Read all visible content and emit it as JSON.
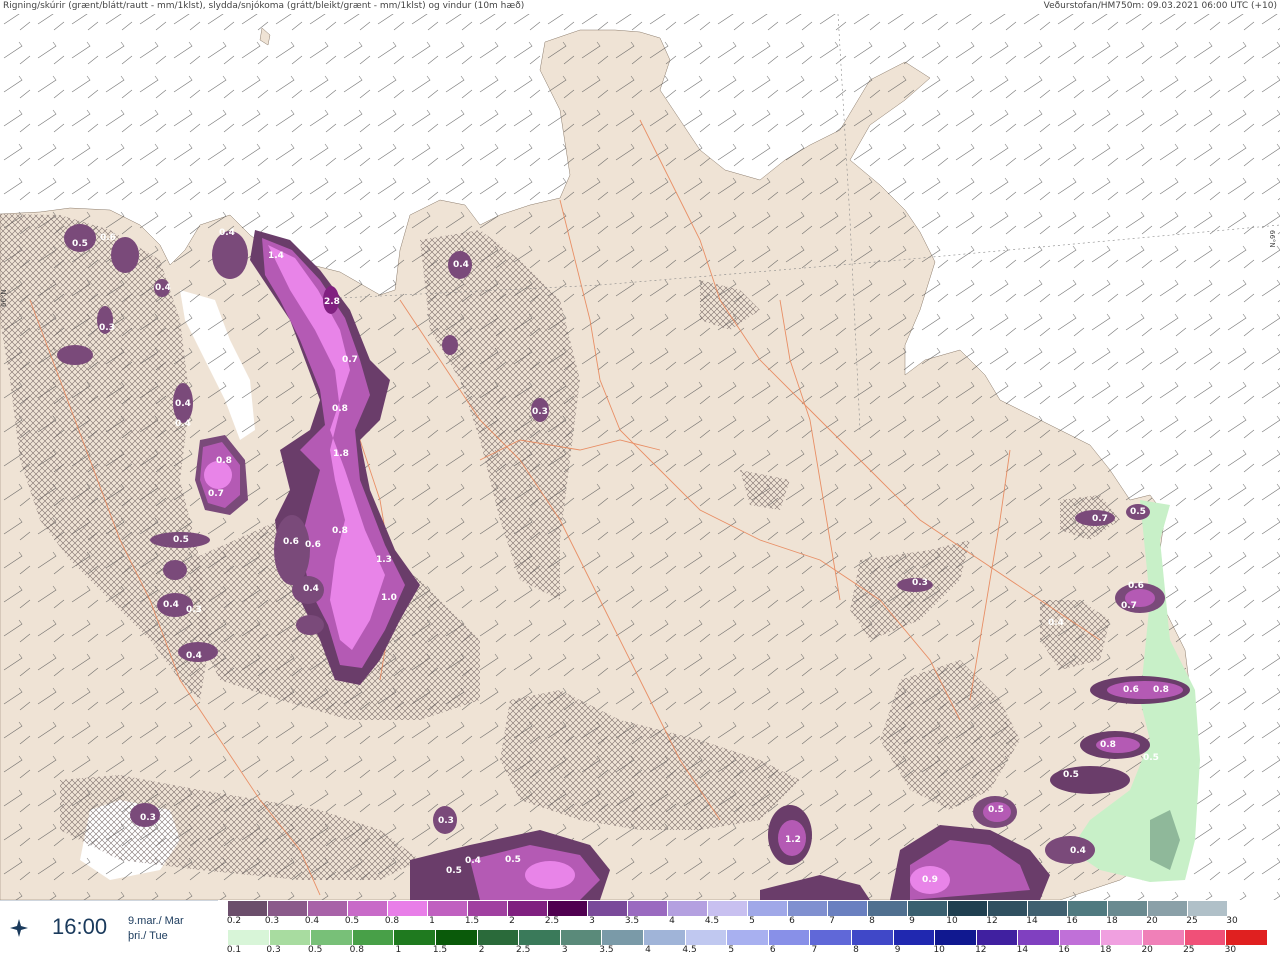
{
  "header": {
    "left": "Rigning/skúrir (grænt/blátt/rautt - mm/1klst), slydda/snjókoma (grátt/bleikt/grænt - mm/1klst) og vindur (10m hæð)",
    "right": "Veðurstofan/HM750m: 09.03.2021 06:00 UTC (+10)"
  },
  "lat_label": "66°N",
  "time": {
    "clock": "16:00",
    "date_line1": "9.mar./ Mar",
    "date_line2": "þri./ Tue"
  },
  "colors": {
    "land": "#efe3d5",
    "sea": "#ffffff",
    "roads": "#e8865a",
    "snow_light": "#7a4a7a",
    "snow_mid": "#b45ab4",
    "snow_heavy": "#e884e8",
    "rain_light": "#c8f0c8"
  },
  "legend": {
    "snow_labels": [
      "0.2",
      "0.3",
      "0.4",
      "0.5",
      "0.8",
      "1",
      "1.5",
      "2",
      "2.5",
      "3",
      "3.5",
      "4",
      "4.5",
      "5",
      "6",
      "7",
      "8",
      "9",
      "10",
      "12",
      "14",
      "16",
      "18",
      "20",
      "25",
      "30"
    ],
    "snow_colors": [
      "#6b4e6b",
      "#8a5a8a",
      "#a862a8",
      "#c86ac8",
      "#e87ee8",
      "#c060c0",
      "#a040a0",
      "#802080",
      "#500050",
      "#7a4a9a",
      "#9a6ac0",
      "#b4a0e0",
      "#c8c0f0",
      "#a0a8e8",
      "#8090d0",
      "#6a80c0",
      "#507090",
      "#3a6070",
      "#204050",
      "#305060",
      "#406070",
      "#507a80",
      "#6a8a90",
      "#8aa0a8",
      "#b0c0c8",
      "#ffffff"
    ],
    "rain_labels": [
      "0.1",
      "0.3",
      "0.5",
      "0.8",
      "1",
      "1.5",
      "2",
      "2.5",
      "3",
      "3.5",
      "4",
      "4.5",
      "5",
      "6",
      "7",
      "8",
      "9",
      "10",
      "12",
      "14",
      "16",
      "18",
      "20",
      "25",
      "30"
    ],
    "rain_colors": [
      "#d8f5d8",
      "#a8dca0",
      "#78c078",
      "#48a048",
      "#1f7a1f",
      "#0a5a0a",
      "#2a6a3a",
      "#3a7a5a",
      "#5a8a7a",
      "#7a9aa8",
      "#a0b4d8",
      "#c0c8f0",
      "#a8b0f0",
      "#8890e8",
      "#6068d8",
      "#4048c8",
      "#2028b0",
      "#101890",
      "#4020a0",
      "#8040c0",
      "#c070d8",
      "#f0a0e0",
      "#f080b8",
      "#f05078",
      "#e02020"
    ]
  },
  "map_labels": [
    {
      "v": "0.5"
    },
    {
      "v": "0.6"
    },
    {
      "v": "0.4"
    },
    {
      "v": "1.4"
    },
    {
      "v": "2.8"
    },
    {
      "v": "0.7"
    },
    {
      "v": "0.8"
    },
    {
      "v": "1.8"
    },
    {
      "v": "0.8"
    },
    {
      "v": "0.7"
    },
    {
      "v": "0.5"
    },
    {
      "v": "0.4"
    },
    {
      "v": "0.4"
    },
    {
      "v": "0.6"
    },
    {
      "v": "0.6"
    },
    {
      "v": "0.8"
    },
    {
      "v": "1.3"
    },
    {
      "v": "1.0"
    },
    {
      "v": "0.4"
    },
    {
      "v": "0.4"
    },
    {
      "v": "0.3"
    },
    {
      "v": "0.4"
    },
    {
      "v": "0.3"
    },
    {
      "v": "0.4"
    },
    {
      "v": "0.3"
    },
    {
      "v": "0.3"
    },
    {
      "v": "0.3"
    },
    {
      "v": "0.4"
    },
    {
      "v": "0.5"
    },
    {
      "v": "0.5"
    },
    {
      "v": "1.2"
    },
    {
      "v": "0.9"
    },
    {
      "v": "0.7"
    },
    {
      "v": "0.5"
    },
    {
      "v": "0.7"
    },
    {
      "v": "0.6"
    },
    {
      "v": "0.8"
    },
    {
      "v": "0.8"
    },
    {
      "v": "0.5"
    },
    {
      "v": "0.5"
    },
    {
      "v": "0.4"
    },
    {
      "v": "0.6"
    },
    {
      "v": "0.3"
    },
    {
      "v": "0.5"
    },
    {
      "v": "0.4"
    },
    {
      "v": "0.4"
    }
  ]
}
